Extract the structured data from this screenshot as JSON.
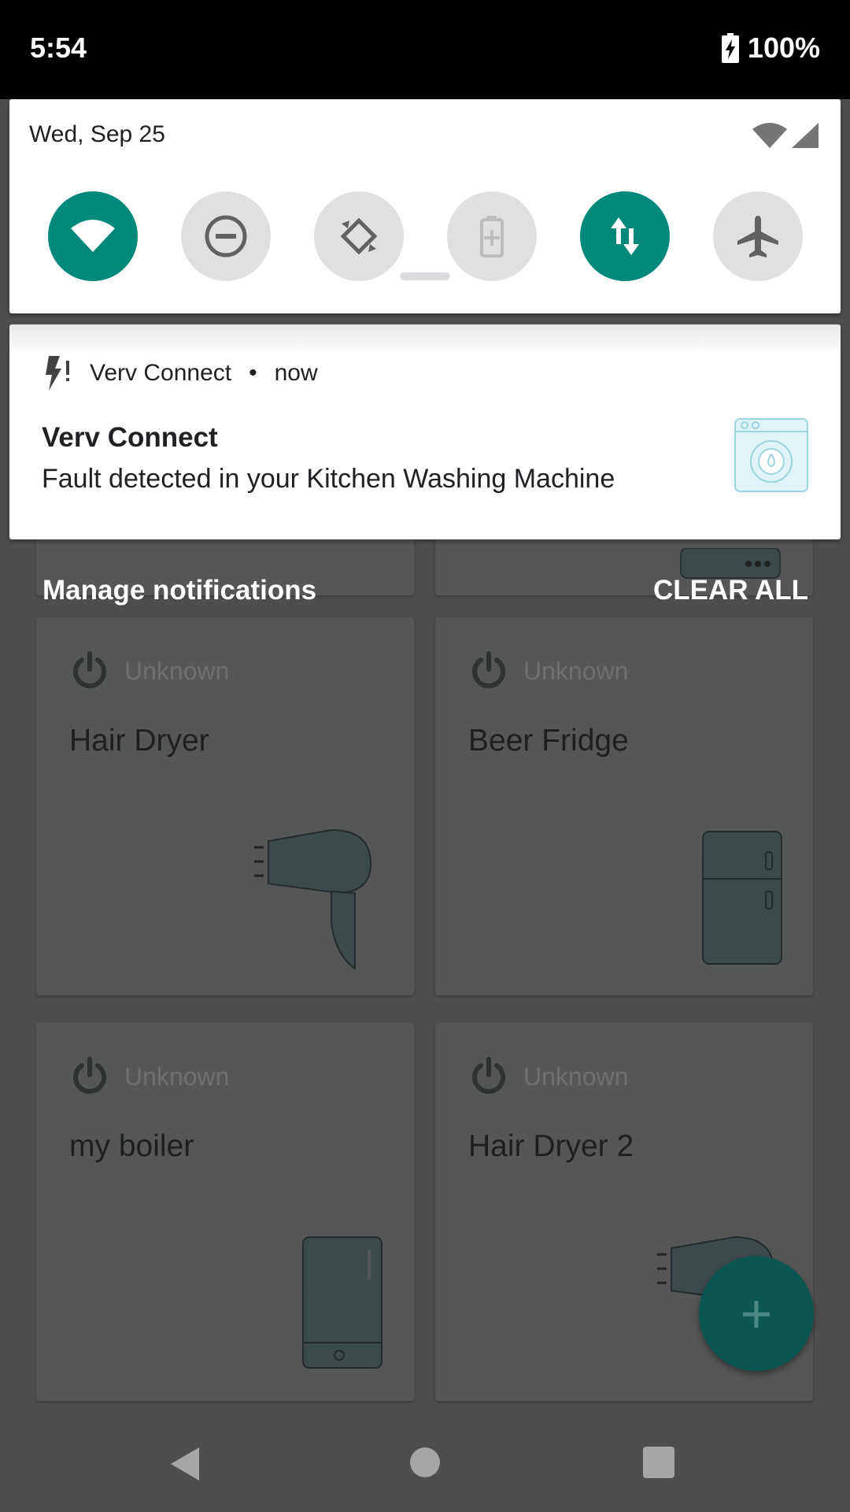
{
  "status_bar": {
    "time": "5:54",
    "battery": "100%"
  },
  "quick_settings": {
    "date": "Wed, Sep 25",
    "tiles": [
      {
        "name": "wifi",
        "active": true
      },
      {
        "name": "do-not-disturb",
        "active": false
      },
      {
        "name": "auto-rotate",
        "active": false
      },
      {
        "name": "battery-saver",
        "active": false
      },
      {
        "name": "mobile-data",
        "active": true
      },
      {
        "name": "airplane-mode",
        "active": false
      }
    ]
  },
  "notification": {
    "app_name": "Verv Connect",
    "time": "now",
    "title": "Verv Connect",
    "text": "Fault detected in your Kitchen Washing Machine"
  },
  "notification_actions": {
    "manage": "Manage notifications",
    "clear_all": "CLEAR ALL"
  },
  "devices": [
    {
      "state": "Unknown",
      "name": "Hair Dryer"
    },
    {
      "state": "Unknown",
      "name": "Beer Fridge"
    },
    {
      "state": "Unknown",
      "name": "my boiler"
    },
    {
      "state": "Unknown",
      "name": "Hair Dryer 2"
    }
  ],
  "fab": {
    "label": "+"
  },
  "colors": {
    "accent": "#00897b",
    "scrim": "#4d4f4f",
    "status_bar": "#000000"
  }
}
